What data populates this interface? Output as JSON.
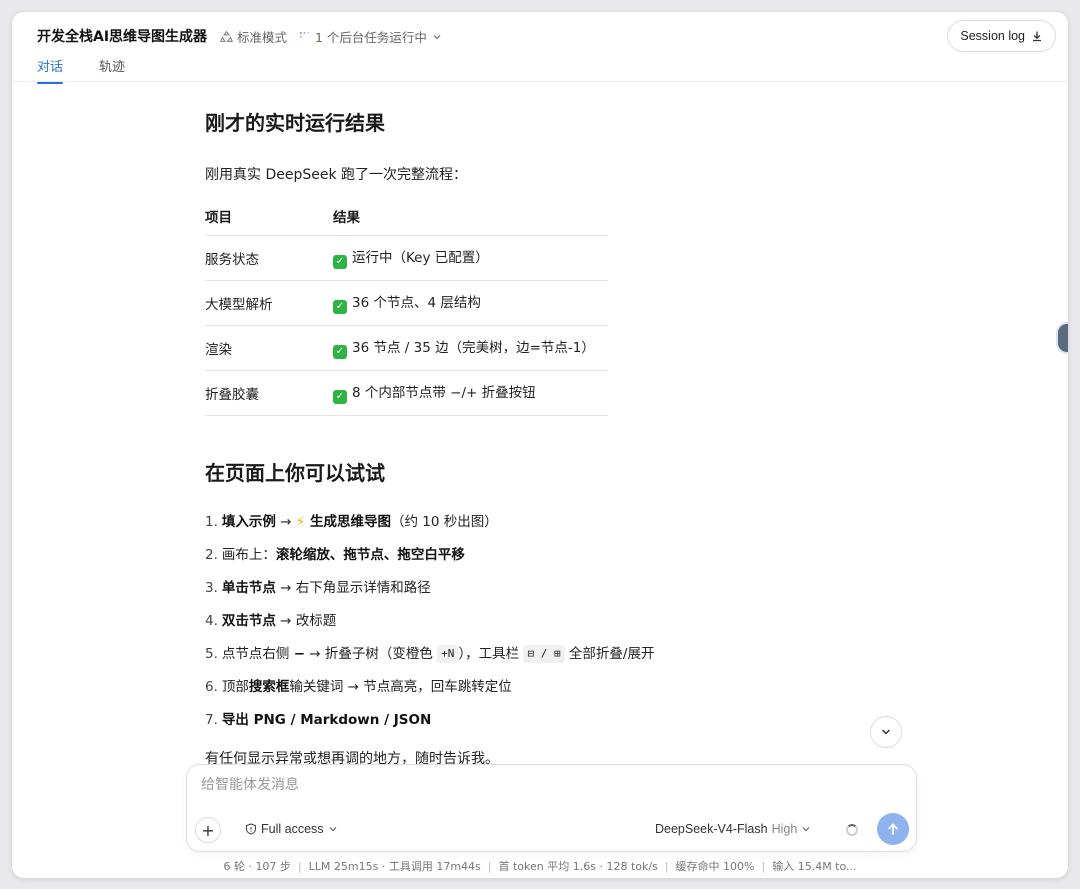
{
  "header": {
    "title": "开发全栈AI思维导图生成器",
    "mode": "标准模式",
    "background_task": "1 个后台任务运行中",
    "session_log": "Session log"
  },
  "tabs": [
    {
      "label": "对话",
      "active": true
    },
    {
      "label": "轨迹",
      "active": false
    }
  ],
  "content": {
    "heading1": "刚才的实时运行结果",
    "intro": "刚用真实 DeepSeek 跑了一次完整流程：",
    "table": {
      "headers": [
        "项目",
        "结果"
      ],
      "rows": [
        {
          "item": "服务状态",
          "result": "运行中（Key 已配置）"
        },
        {
          "item": "大模型解析",
          "result": "36 个节点、4 层结构"
        },
        {
          "item": "渲染",
          "result": "36 节点 / 35 边（完美树，边=节点-1）"
        },
        {
          "item": "折叠胶囊",
          "result": "8 个内部节点带 −/+ 折叠按钮"
        }
      ]
    },
    "heading2": "在页面上你可以试试",
    "tips": {
      "t1": {
        "num": "1.",
        "b1": "填入示例",
        "arrow": " → ",
        "bolt": "⚡",
        "b2": " 生成思维导图",
        "rest": "（约 10 秒出图）"
      },
      "t2": {
        "num": "2.",
        "pre": "画布上：",
        "b1": "滚轮缩放、拖节点、拖空白平移"
      },
      "t3": {
        "num": "3.",
        "b1": "单击节点",
        "rest": " → 右下角显示详情和路径"
      },
      "t4": {
        "num": "4.",
        "b1": "双击节点",
        "rest": " → 改标题"
      },
      "t5": {
        "num": "5.",
        "pre": "点节点右侧 ",
        "b1": "−",
        "mid": " → 折叠子树（变橙色 ",
        "k1": "+N",
        "mid2": "），工具栏 ",
        "k2": "⊟ / ⊞",
        "rest": " 全部折叠/展开"
      },
      "t6": {
        "num": "6.",
        "pre": "顶部",
        "b1": "搜索框",
        "rest": "输关键词 → 节点高亮，回车跳转定位"
      },
      "t7": {
        "num": "7.",
        "b1": "导出 PNG / Markdown / JSON"
      }
    },
    "outro": "有任何显示异常或想再调的地方，随时告诉我。"
  },
  "composer": {
    "placeholder": "给智能体发消息",
    "access": "Full access",
    "model": "DeepSeek-V4-Flash",
    "level": "High"
  },
  "status": {
    "s1": "6 轮 · 107 步",
    "s2": "LLM 25m15s · 工具调用 17m44s",
    "s3": "首 token 平均 1.6s · 128 tok/s",
    "s4": "缓存命中 100%",
    "s5": "输入 15.4M to..."
  },
  "colors": {
    "accent": "#2b6fd6",
    "check": "#2fb344",
    "send": "#8fb3ee"
  }
}
